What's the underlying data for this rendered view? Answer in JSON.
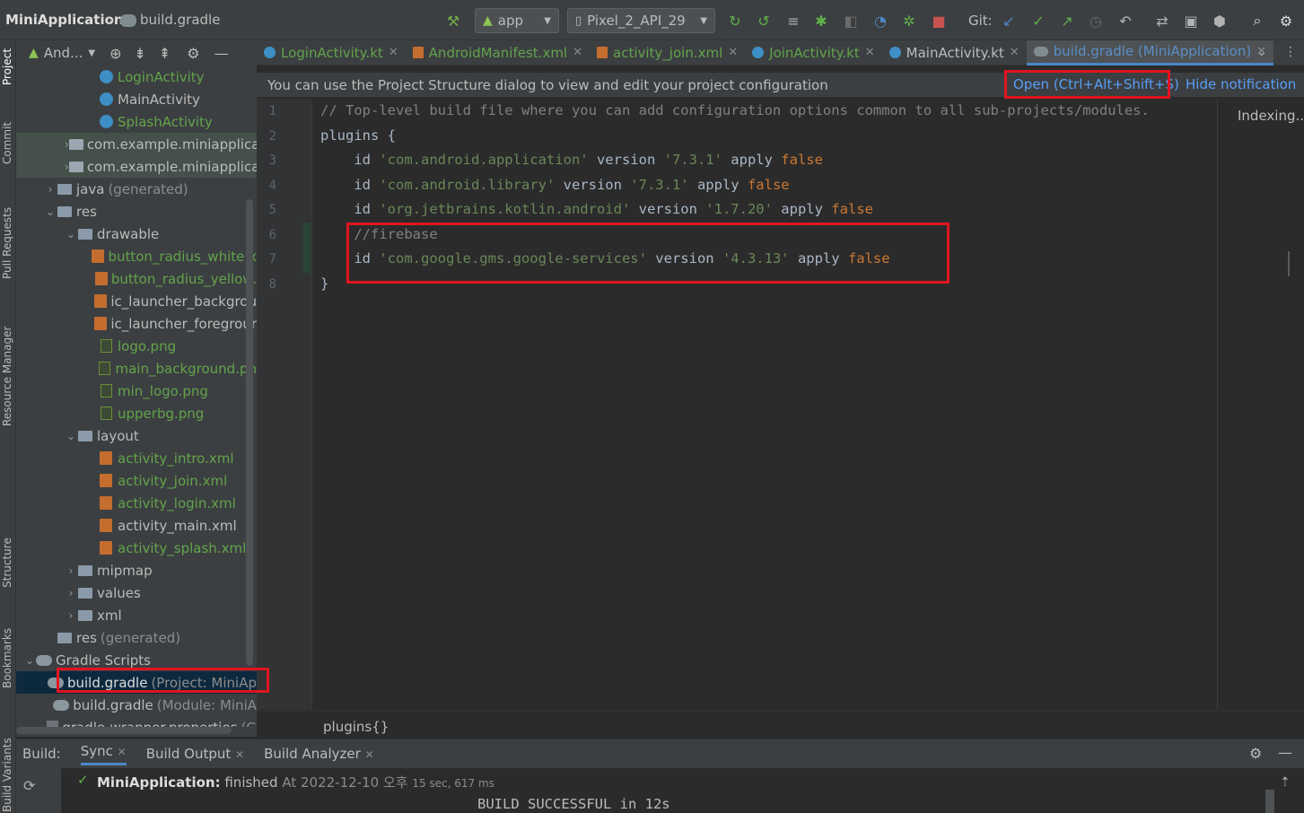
{
  "toolbar": {
    "project_name": "MiniApplication",
    "file_crumb": "build.gradle",
    "run_config": "app",
    "device": "Pixel_2_API_29",
    "git_label": "Git:"
  },
  "left_strip": {
    "labels": [
      "Project",
      "Commit",
      "Pull Requests",
      "Resource Manager",
      "Structure",
      "Bookmarks",
      "Build Variants"
    ]
  },
  "project_panel": {
    "dropdown": "And...",
    "tree": [
      {
        "label": "LoginActivity",
        "suffix": "",
        "indent": 3,
        "icon": "kotlin-class-icon",
        "arrow": "",
        "color": "green"
      },
      {
        "label": "MainActivity",
        "suffix": "",
        "indent": 3,
        "icon": "kotlin-class-icon",
        "arrow": "",
        "color": "normal"
      },
      {
        "label": "SplashActivity",
        "suffix": "",
        "indent": 3,
        "icon": "kotlin-class-icon",
        "arrow": "",
        "color": "green"
      },
      {
        "label": "com.example.miniapplica",
        "suffix": "",
        "indent": 2,
        "icon": "package-icon",
        "arrow": ">",
        "color": "normal",
        "hl": true
      },
      {
        "label": "com.example.miniapplica",
        "suffix": "",
        "indent": 2,
        "icon": "package-icon",
        "arrow": ">",
        "color": "normal",
        "hl": true
      },
      {
        "label": "java",
        "suffix": "(generated)",
        "indent": 1,
        "icon": "folder-icon",
        "arrow": ">",
        "color": "normal"
      },
      {
        "label": "res",
        "suffix": "",
        "indent": 1,
        "icon": "folder-icon",
        "arrow": "v",
        "color": "normal"
      },
      {
        "label": "drawable",
        "suffix": "",
        "indent": 2,
        "icon": "folder-icon",
        "arrow": "v",
        "color": "normal"
      },
      {
        "label": "button_radius_white.x",
        "suffix": "",
        "indent": 3,
        "icon": "xml-file-icon",
        "arrow": "",
        "color": "green"
      },
      {
        "label": "button_radius_yellow.",
        "suffix": "",
        "indent": 3,
        "icon": "xml-file-icon",
        "arrow": "",
        "color": "green"
      },
      {
        "label": "ic_launcher_backgrou",
        "suffix": "",
        "indent": 3,
        "icon": "xml-file-icon",
        "arrow": "",
        "color": "normal"
      },
      {
        "label": "ic_launcher_foregrour",
        "suffix": "",
        "indent": 3,
        "icon": "xml-file-icon",
        "arrow": "",
        "color": "normal"
      },
      {
        "label": "logo.png",
        "suffix": "",
        "indent": 3,
        "icon": "image-file-icon",
        "arrow": "",
        "color": "green"
      },
      {
        "label": "main_background.pn",
        "suffix": "",
        "indent": 3,
        "icon": "image-file-icon",
        "arrow": "",
        "color": "green"
      },
      {
        "label": "min_logo.png",
        "suffix": "",
        "indent": 3,
        "icon": "image-file-icon",
        "arrow": "",
        "color": "green"
      },
      {
        "label": "upperbg.png",
        "suffix": "",
        "indent": 3,
        "icon": "image-file-icon",
        "arrow": "",
        "color": "green"
      },
      {
        "label": "layout",
        "suffix": "",
        "indent": 2,
        "icon": "folder-icon",
        "arrow": "v",
        "color": "normal"
      },
      {
        "label": "activity_intro.xml",
        "suffix": "",
        "indent": 3,
        "icon": "xml-file-icon",
        "arrow": "",
        "color": "green"
      },
      {
        "label": "activity_join.xml",
        "suffix": "",
        "indent": 3,
        "icon": "xml-file-icon",
        "arrow": "",
        "color": "green"
      },
      {
        "label": "activity_login.xml",
        "suffix": "",
        "indent": 3,
        "icon": "xml-file-icon",
        "arrow": "",
        "color": "green"
      },
      {
        "label": "activity_main.xml",
        "suffix": "",
        "indent": 3,
        "icon": "xml-file-icon",
        "arrow": "",
        "color": "normal"
      },
      {
        "label": "activity_splash.xml",
        "suffix": "",
        "indent": 3,
        "icon": "xml-file-icon",
        "arrow": "",
        "color": "green"
      },
      {
        "label": "mipmap",
        "suffix": "",
        "indent": 2,
        "icon": "folder-icon",
        "arrow": ">",
        "color": "normal"
      },
      {
        "label": "values",
        "suffix": "",
        "indent": 2,
        "icon": "folder-icon",
        "arrow": ">",
        "color": "normal"
      },
      {
        "label": "xml",
        "suffix": "",
        "indent": 2,
        "icon": "folder-icon",
        "arrow": ">",
        "color": "normal"
      },
      {
        "label": "res",
        "suffix": "(generated)",
        "indent": 1,
        "icon": "folder-icon",
        "arrow": "",
        "color": "normal"
      },
      {
        "label": "Gradle Scripts",
        "suffix": "",
        "indent": 0,
        "icon": "gradle-icon",
        "arrow": "v",
        "color": "normal"
      },
      {
        "label": "build.gradle",
        "suffix": "(Project: MiniAp",
        "indent": 1,
        "icon": "gradle-icon",
        "arrow": "",
        "color": "selected",
        "selected": true
      },
      {
        "label": "build.gradle",
        "suffix": "(Module: MiniA",
        "indent": 1,
        "icon": "gradle-icon",
        "arrow": "",
        "color": "normal"
      },
      {
        "label": "gradle-wrapper.properties",
        "suffix": "(G",
        "indent": 1,
        "icon": "properties-icon",
        "arrow": "",
        "color": "normal"
      }
    ]
  },
  "tabs": [
    {
      "label": "LoginActivity.kt",
      "color": "green"
    },
    {
      "label": "AndroidManifest.xml",
      "color": "green"
    },
    {
      "label": "activity_join.xml",
      "color": "green"
    },
    {
      "label": "JoinActivity.kt",
      "color": "green"
    },
    {
      "label": "MainActivity.kt",
      "color": "normal"
    },
    {
      "label": "build.gradle (MiniApplication)",
      "color": "blue",
      "active": true
    }
  ],
  "notification": {
    "text": "You can use the Project Structure dialog to view and edit your project configuration",
    "open_link": "Open (Ctrl+Alt+Shift+S)",
    "hide_link": "Hide notification"
  },
  "editor": {
    "status": "Indexing...",
    "breadcrumb": "plugins{}",
    "lines": [
      "// Top-level build file where you can add configuration options common to all sub-projects/modules.",
      "plugins {",
      "    id 'com.android.application' version '7.3.1' apply false",
      "    id 'com.android.library' version '7.3.1' apply false",
      "    id 'org.jetbrains.kotlin.android' version '1.7.20' apply false",
      "    //firebase",
      "    id 'com.google.gms.google-services' version '4.3.13' apply false",
      "}"
    ],
    "line_numbers": [
      "1",
      "2",
      "3",
      "4",
      "5",
      "6",
      "7",
      "8"
    ]
  },
  "build": {
    "label": "Build:",
    "tabs": [
      "Sync",
      "Build Output",
      "Build Analyzer"
    ],
    "task": "MiniApplication:",
    "task_status": "finished",
    "timestamp": "At 2022-12-10 오후",
    "duration": "15 sec, 617 ms",
    "output": "BUILD SUCCESSFUL in 12s"
  },
  "colors": {
    "accent": "#4a88c7",
    "highlight_box": "#e0151f",
    "modified_file": "#62a34b"
  }
}
